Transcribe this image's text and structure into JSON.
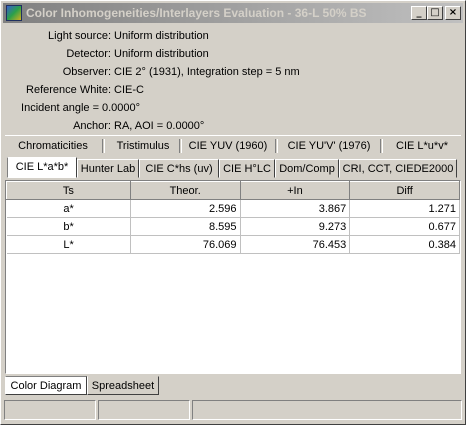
{
  "window": {
    "title": "Color Inhomogeneities/Interlayers Evaluation - 36-L 50% BS",
    "icon": "app-icon",
    "controls": {
      "minimize": "_",
      "maximize": "□",
      "close": "×"
    }
  },
  "info": [
    {
      "label": "Light source:",
      "value": "Uniform distribution"
    },
    {
      "label": "Detector:",
      "value": "Uniform distribution"
    },
    {
      "label": "Observer:",
      "value": "CIE 2° (1931),   Integration step = 5 nm"
    },
    {
      "label": "Reference White:",
      "value": "CIE-C"
    },
    {
      "label": "Incident angle =",
      "value": "0.0000°"
    },
    {
      "label": "Anchor:",
      "value": "RA,   AOI =  0.0000°"
    }
  ],
  "tabs_row1": [
    "Chromaticities",
    "Tristimulus",
    "CIE YUV (1960)",
    "CIE YU'V' (1976)",
    "CIE L*u*v*"
  ],
  "tabs_row2": {
    "items": [
      "CIE L*a*b*",
      "Hunter Lab",
      "CIE C*hs (uv)",
      "CIE H°LC",
      "Dom/Comp",
      "CRI, CCT, CIEDE2000"
    ],
    "active": "CIE L*a*b*"
  },
  "table": {
    "headers": [
      "Ts",
      "Theor.",
      "+In",
      "Diff"
    ],
    "rows": [
      [
        "a*",
        "2.596",
        "3.867",
        "1.271"
      ],
      [
        "b*",
        "8.595",
        "9.273",
        "0.677"
      ],
      [
        "L*",
        "76.069",
        "76.453",
        "0.384"
      ]
    ]
  },
  "bottom_tabs": {
    "items": [
      "Color Diagram",
      "Spreadsheet"
    ],
    "active": "Color Diagram"
  },
  "status": [
    "",
    "",
    ""
  ]
}
